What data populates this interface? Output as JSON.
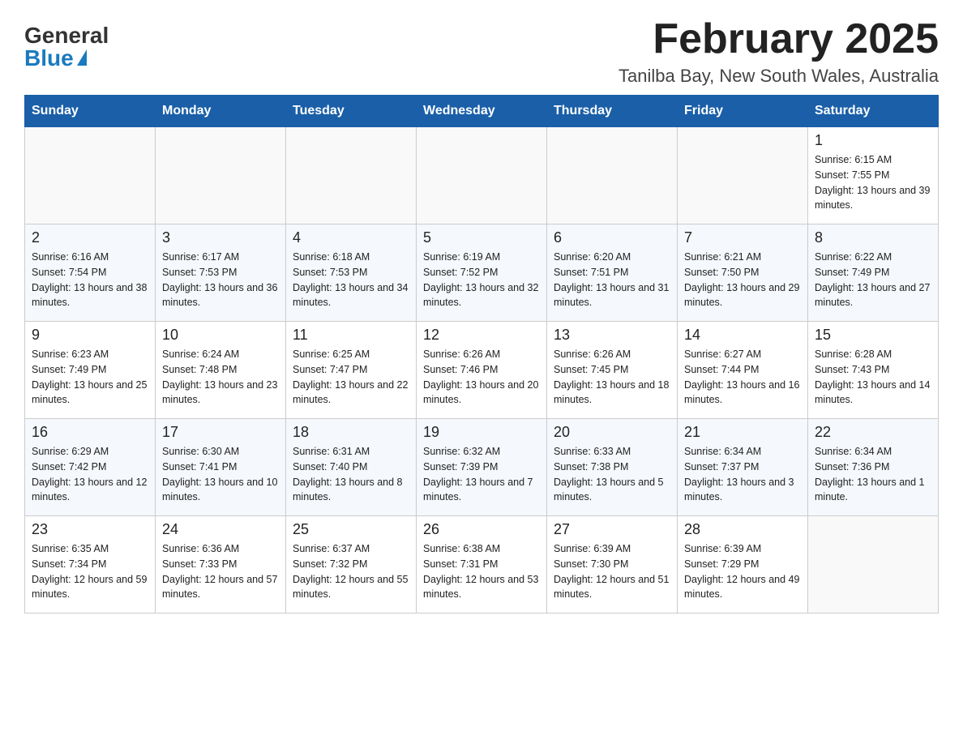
{
  "header": {
    "logo_general": "General",
    "logo_blue": "Blue",
    "title": "February 2025",
    "subtitle": "Tanilba Bay, New South Wales, Australia"
  },
  "days_of_week": [
    "Sunday",
    "Monday",
    "Tuesday",
    "Wednesday",
    "Thursday",
    "Friday",
    "Saturday"
  ],
  "weeks": [
    [
      {
        "day": "",
        "info": ""
      },
      {
        "day": "",
        "info": ""
      },
      {
        "day": "",
        "info": ""
      },
      {
        "day": "",
        "info": ""
      },
      {
        "day": "",
        "info": ""
      },
      {
        "day": "",
        "info": ""
      },
      {
        "day": "1",
        "info": "Sunrise: 6:15 AM\nSunset: 7:55 PM\nDaylight: 13 hours and 39 minutes."
      }
    ],
    [
      {
        "day": "2",
        "info": "Sunrise: 6:16 AM\nSunset: 7:54 PM\nDaylight: 13 hours and 38 minutes."
      },
      {
        "day": "3",
        "info": "Sunrise: 6:17 AM\nSunset: 7:53 PM\nDaylight: 13 hours and 36 minutes."
      },
      {
        "day": "4",
        "info": "Sunrise: 6:18 AM\nSunset: 7:53 PM\nDaylight: 13 hours and 34 minutes."
      },
      {
        "day": "5",
        "info": "Sunrise: 6:19 AM\nSunset: 7:52 PM\nDaylight: 13 hours and 32 minutes."
      },
      {
        "day": "6",
        "info": "Sunrise: 6:20 AM\nSunset: 7:51 PM\nDaylight: 13 hours and 31 minutes."
      },
      {
        "day": "7",
        "info": "Sunrise: 6:21 AM\nSunset: 7:50 PM\nDaylight: 13 hours and 29 minutes."
      },
      {
        "day": "8",
        "info": "Sunrise: 6:22 AM\nSunset: 7:49 PM\nDaylight: 13 hours and 27 minutes."
      }
    ],
    [
      {
        "day": "9",
        "info": "Sunrise: 6:23 AM\nSunset: 7:49 PM\nDaylight: 13 hours and 25 minutes."
      },
      {
        "day": "10",
        "info": "Sunrise: 6:24 AM\nSunset: 7:48 PM\nDaylight: 13 hours and 23 minutes."
      },
      {
        "day": "11",
        "info": "Sunrise: 6:25 AM\nSunset: 7:47 PM\nDaylight: 13 hours and 22 minutes."
      },
      {
        "day": "12",
        "info": "Sunrise: 6:26 AM\nSunset: 7:46 PM\nDaylight: 13 hours and 20 minutes."
      },
      {
        "day": "13",
        "info": "Sunrise: 6:26 AM\nSunset: 7:45 PM\nDaylight: 13 hours and 18 minutes."
      },
      {
        "day": "14",
        "info": "Sunrise: 6:27 AM\nSunset: 7:44 PM\nDaylight: 13 hours and 16 minutes."
      },
      {
        "day": "15",
        "info": "Sunrise: 6:28 AM\nSunset: 7:43 PM\nDaylight: 13 hours and 14 minutes."
      }
    ],
    [
      {
        "day": "16",
        "info": "Sunrise: 6:29 AM\nSunset: 7:42 PM\nDaylight: 13 hours and 12 minutes."
      },
      {
        "day": "17",
        "info": "Sunrise: 6:30 AM\nSunset: 7:41 PM\nDaylight: 13 hours and 10 minutes."
      },
      {
        "day": "18",
        "info": "Sunrise: 6:31 AM\nSunset: 7:40 PM\nDaylight: 13 hours and 8 minutes."
      },
      {
        "day": "19",
        "info": "Sunrise: 6:32 AM\nSunset: 7:39 PM\nDaylight: 13 hours and 7 minutes."
      },
      {
        "day": "20",
        "info": "Sunrise: 6:33 AM\nSunset: 7:38 PM\nDaylight: 13 hours and 5 minutes."
      },
      {
        "day": "21",
        "info": "Sunrise: 6:34 AM\nSunset: 7:37 PM\nDaylight: 13 hours and 3 minutes."
      },
      {
        "day": "22",
        "info": "Sunrise: 6:34 AM\nSunset: 7:36 PM\nDaylight: 13 hours and 1 minute."
      }
    ],
    [
      {
        "day": "23",
        "info": "Sunrise: 6:35 AM\nSunset: 7:34 PM\nDaylight: 12 hours and 59 minutes."
      },
      {
        "day": "24",
        "info": "Sunrise: 6:36 AM\nSunset: 7:33 PM\nDaylight: 12 hours and 57 minutes."
      },
      {
        "day": "25",
        "info": "Sunrise: 6:37 AM\nSunset: 7:32 PM\nDaylight: 12 hours and 55 minutes."
      },
      {
        "day": "26",
        "info": "Sunrise: 6:38 AM\nSunset: 7:31 PM\nDaylight: 12 hours and 53 minutes."
      },
      {
        "day": "27",
        "info": "Sunrise: 6:39 AM\nSunset: 7:30 PM\nDaylight: 12 hours and 51 minutes."
      },
      {
        "day": "28",
        "info": "Sunrise: 6:39 AM\nSunset: 7:29 PM\nDaylight: 12 hours and 49 minutes."
      },
      {
        "day": "",
        "info": ""
      }
    ]
  ]
}
